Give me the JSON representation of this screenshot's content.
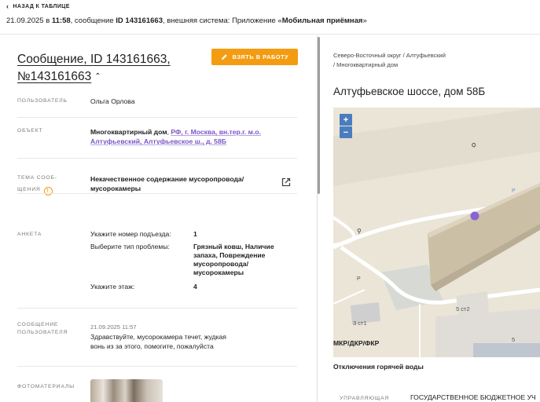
{
  "topbar": {
    "back_label": "НАЗАД К ТАБЛИЦЕ",
    "date": "21.09.2025",
    "in": "в",
    "time": "11:58",
    "msg_prefix": ", сообщение",
    "msg_id": "ID 143161663",
    "system_text": ", внешняя система: Приложение «",
    "system_name": "Мобильная приёмная",
    "system_close": "»"
  },
  "message": {
    "title_line1": "Сообщение, ID 143161663,",
    "title_line2": "№143161663",
    "take_button": "ВЗЯТЬ В РАБОТУ"
  },
  "fields": {
    "user_label": "ПОЛЬЗОВАТЕЛЬ",
    "user_value": "Ольга Орлова",
    "object_label": "ОБЪЕКТ",
    "object_type": "Многоквартирный дом",
    "object_sep": ", ",
    "object_address_line1": "РФ, г. Москва, вн.тер.г. м.о.",
    "object_address_line2": "Алтуфьевский, Алтуфьевское ш., д. 58Б",
    "topic_label_1": "ТЕМА СООБ-",
    "topic_label_2": "ЩЕНИЯ",
    "topic_warn": "!",
    "topic_value_1": "Некачественное содержание мусоропровода/",
    "topic_value_2": "мусорокамеры",
    "survey_label": "АНКЕТА",
    "survey": [
      {
        "q": "Укажите номер подъезда:",
        "a": "1"
      },
      {
        "q": "Выберите тип проблемы:",
        "a": "Грязный ковш, Наличие запаха, Повреждение мусоропровода/ мусорокамеры"
      },
      {
        "q": "Укажите этаж:",
        "a": "4"
      }
    ],
    "usermsg_label_1": "СООБЩЕНИЕ",
    "usermsg_label_2": "ПОЛЬЗОВАТЕЛЯ",
    "usermsg_date": "21.09.2025 11:57",
    "usermsg_text_1": "Здравствуйте, мусорокамера течет, жудкая",
    "usermsg_text_2": "вонь из за этого, помогите, пожалуйста",
    "photos_label": "ФОТОМАТЕРИАЛЫ"
  },
  "right": {
    "breadcrumb_1": "Северо-Восточный округ / Алтуфьевский",
    "breadcrumb_2": "/ Многоквартирный дом",
    "address_title": "Алтуфьевское шоссе, дом 58Б",
    "map": {
      "zoom_in": "+",
      "zoom_out": "−",
      "label_3ct1": "3 ст1",
      "label_5ct2": "5 ст2",
      "label_5": "5",
      "parking": "P"
    },
    "section_1": "МКР/ДКР/ФКР",
    "section_2": "Отключения горячей воды",
    "mgmt_label": "УПРАВЛЯЮЩАЯ",
    "mgmt_value": "ГОСУДАРСТВЕННОЕ БЮДЖЕТНОЕ УЧ"
  },
  "colors": {
    "accent": "#f39c12",
    "link": "#7b55c8",
    "map_marker": "#8a63d2",
    "zoom_btn": "#4a7dbf"
  }
}
